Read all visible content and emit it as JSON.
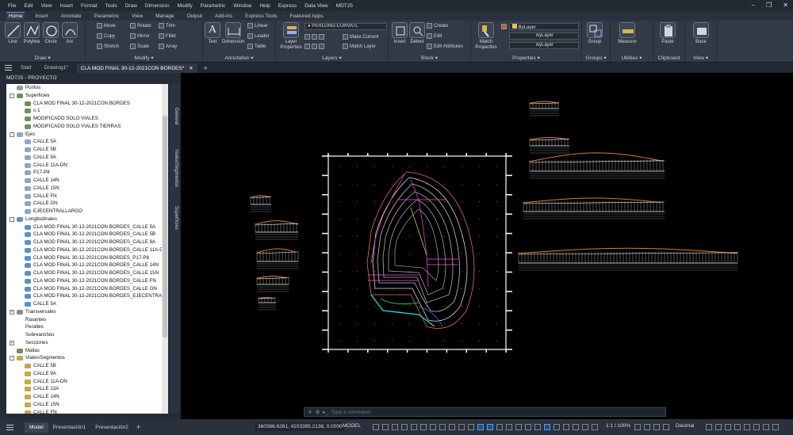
{
  "menu": [
    "File",
    "Edit",
    "View",
    "Insert",
    "Format",
    "Tools",
    "Draw",
    "Dimension",
    "Modify",
    "Parametric",
    "Window",
    "Help",
    "Express",
    "Data View",
    "MDT25"
  ],
  "ribbon_tabs": [
    "Home",
    "Insert",
    "Annotate",
    "Parametric",
    "View",
    "Manage",
    "Output",
    "Add-ins",
    "Express Tools",
    "Featured Apps"
  ],
  "active_ribbon_tab": "Home",
  "panels": {
    "draw": {
      "title": "Draw ▾",
      "tools": [
        "Line",
        "Polyline",
        "Circle",
        "Arc"
      ]
    },
    "modify": {
      "title": "Modify ▾",
      "tools": [
        "Move",
        "Rotate",
        "Trim",
        "Copy",
        "Mirror",
        "Fillet",
        "Stretch",
        "Scale",
        "Array"
      ]
    },
    "annotation": {
      "title": "Annotation ▾",
      "tools": [
        "Text",
        "Dimension",
        "Linear",
        "Leader",
        "Table"
      ]
    },
    "layers": {
      "title": "Layers ▾",
      "big": "Layer Properties",
      "current_layer": "PERLONG-CURVATL",
      "tools": [
        "Make Current",
        "Match Layer"
      ]
    },
    "block": {
      "title": "Block ▾",
      "tools": [
        "Insert",
        "Detect",
        "Create",
        "Edit",
        "Edit Attributes"
      ]
    },
    "properties": {
      "title": "Properties ▾",
      "big": "Match Properties",
      "fields": [
        "ByLayer",
        "ByLayer",
        "ByLayer"
      ]
    },
    "groups": {
      "title": "Groups ▾",
      "big": "Group"
    },
    "utilities": {
      "title": "Utilities ▾",
      "big": "Measure"
    },
    "clipboard": {
      "title": "Clipboard",
      "big": "Paste"
    },
    "view": {
      "title": "View ▾",
      "big": "Base"
    }
  },
  "doc_tabs": [
    "Start",
    "Drawing1*",
    "CLA MOD FINAL 30-12-2021CON BORDES*"
  ],
  "active_doc_tab": "CLA MOD FINAL 30-12-2021CON BORDES*",
  "palette": {
    "title": "MDT25 - PROYECTO",
    "side_tabs": [
      "General",
      "Viales/Segmentos",
      "Superficies"
    ],
    "tree": [
      {
        "label": "Puntos",
        "indent": 0,
        "exp": "",
        "icon": "pt"
      },
      {
        "label": "Superficies",
        "indent": 0,
        "exp": "-",
        "icon": "surf"
      },
      {
        "label": "CLA MOD FINAL 30-12-2021CON BORDES",
        "indent": 1,
        "exp": "",
        "icon": "surf"
      },
      {
        "label": "c-1",
        "indent": 1,
        "exp": "",
        "icon": "surf"
      },
      {
        "label": "MODIFICADO SOLO VIALES",
        "indent": 1,
        "exp": "",
        "icon": "surf"
      },
      {
        "label": "MODIFICADO SOLO VIALES TIERRAS",
        "indent": 1,
        "exp": "",
        "icon": "surf"
      },
      {
        "label": "Ejes",
        "indent": 0,
        "exp": "-",
        "icon": "axis"
      },
      {
        "label": "CALLE 5A",
        "indent": 1,
        "exp": "",
        "icon": "axis"
      },
      {
        "label": "CALLE 5B",
        "indent": 1,
        "exp": "",
        "icon": "axis"
      },
      {
        "label": "CALLE 9A",
        "indent": 1,
        "exp": "",
        "icon": "axis"
      },
      {
        "label": "CALLE 11A-DN",
        "indent": 1,
        "exp": "",
        "icon": "axis"
      },
      {
        "label": "P17-P8",
        "indent": 1,
        "exp": "",
        "icon": "axis"
      },
      {
        "label": "CALLE 14N",
        "indent": 1,
        "exp": "",
        "icon": "axis"
      },
      {
        "label": "CALLE 15N",
        "indent": 1,
        "exp": "",
        "icon": "axis"
      },
      {
        "label": "CALLE FN",
        "indent": 1,
        "exp": "",
        "icon": "axis"
      },
      {
        "label": "CALLE GN",
        "indent": 1,
        "exp": "",
        "icon": "axis"
      },
      {
        "label": "EJECENTRALLARGO",
        "indent": 1,
        "exp": "",
        "icon": "axis"
      },
      {
        "label": "Longitudinales",
        "indent": 0,
        "exp": "-",
        "icon": "long"
      },
      {
        "label": "CLA MOD FINAL 30-12-2021CON BORDES_CALLE 5A",
        "indent": 1,
        "exp": "",
        "icon": "long"
      },
      {
        "label": "CLA MOD FINAL 30-12-2021CON BORDES_CALLE 5B",
        "indent": 1,
        "exp": "",
        "icon": "long"
      },
      {
        "label": "CLA MOD FINAL 30-12-2021CON BORDES_CALLE 9A",
        "indent": 1,
        "exp": "",
        "icon": "long"
      },
      {
        "label": "CLA MOD FINAL 30-12-2021CON BORDES_CALLE 11A-D",
        "indent": 1,
        "exp": "",
        "icon": "long"
      },
      {
        "label": "CLA MOD FINAL 30-12-2021CON BORDES_P17-P8",
        "indent": 1,
        "exp": "",
        "icon": "long"
      },
      {
        "label": "CLA MOD FINAL 30-12-2021CON BORDES_CALLE 14N",
        "indent": 1,
        "exp": "",
        "icon": "long"
      },
      {
        "label": "CLA MOD FINAL 30-12-2021CON BORDES_CALLE 15N",
        "indent": 1,
        "exp": "",
        "icon": "long"
      },
      {
        "label": "CLA MOD FINAL 30-12-2021CON BORDES_CALLE FN",
        "indent": 1,
        "exp": "",
        "icon": "long"
      },
      {
        "label": "CLA MOD FINAL 30-12-2021CON BORDES_CALLE GN",
        "indent": 1,
        "exp": "",
        "icon": "long"
      },
      {
        "label": "CLA MOD FINAL 30-12-2021CON BORDES_EJECENTRALL",
        "indent": 1,
        "exp": "",
        "icon": "long"
      },
      {
        "label": "CALLE 5A",
        "indent": 1,
        "exp": "",
        "icon": "long"
      },
      {
        "label": "Transversales",
        "indent": 0,
        "exp": "+",
        "icon": "trans"
      },
      {
        "label": "Rasantes",
        "indent": 0,
        "exp": "",
        "icon": "plain"
      },
      {
        "label": "Peraltes",
        "indent": 0,
        "exp": "",
        "icon": "plain"
      },
      {
        "label": "Sobreanchos",
        "indent": 0,
        "exp": "",
        "icon": "plain"
      },
      {
        "label": "Secciones",
        "indent": 0,
        "exp": "+",
        "icon": "plain"
      },
      {
        "label": "Mallas",
        "indent": 0,
        "exp": "",
        "icon": "mesh"
      },
      {
        "label": "Viales/Segmentos",
        "indent": 0,
        "exp": "-",
        "icon": "road"
      },
      {
        "label": "CALLE 5B",
        "indent": 1,
        "exp": "",
        "icon": "road"
      },
      {
        "label": "CALLE 9A",
        "indent": 1,
        "exp": "",
        "icon": "road"
      },
      {
        "label": "CALLE 11A-DN",
        "indent": 1,
        "exp": "",
        "icon": "road"
      },
      {
        "label": "CALLE 13A",
        "indent": 1,
        "exp": "",
        "icon": "road"
      },
      {
        "label": "CALLE 14N",
        "indent": 1,
        "exp": "",
        "icon": "road"
      },
      {
        "label": "CALLE 15N",
        "indent": 1,
        "exp": "",
        "icon": "road"
      },
      {
        "label": "CALLE FN",
        "indent": 1,
        "exp": "",
        "icon": "road"
      }
    ]
  },
  "command": {
    "placeholder": "Type a command"
  },
  "status": {
    "layout_tabs": [
      "Model",
      "Presentación1",
      "Presentación2"
    ],
    "active_layout": "Model",
    "coordinates": "360366.6261, 4103395.2136, 0.0000",
    "mode": "MODEL",
    "scale": "1:1 / 100%",
    "units": "Decimal"
  },
  "colors": {
    "accent": "#5b8fd9",
    "tree_bg": "#ffffff",
    "canvas_bg": "#000000"
  }
}
